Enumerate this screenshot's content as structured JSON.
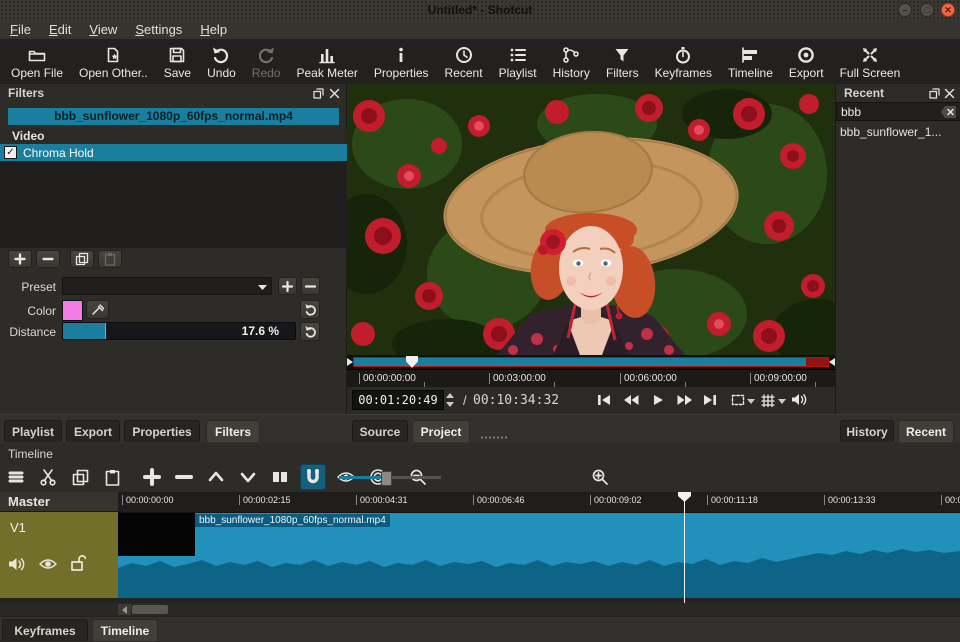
{
  "window": {
    "title": "Untitled* - Shotcut",
    "controls": [
      "minimize",
      "maximize",
      "close"
    ]
  },
  "menu": {
    "items": [
      "File",
      "Edit",
      "View",
      "Settings",
      "Help"
    ]
  },
  "toolbar": {
    "items": [
      {
        "label": "Open File",
        "icon": "open-file-icon"
      },
      {
        "label": "Open Other..",
        "icon": "open-other-icon"
      },
      {
        "label": "Save",
        "icon": "save-icon"
      },
      {
        "label": "Undo",
        "icon": "undo-icon"
      },
      {
        "label": "Redo",
        "icon": "redo-icon",
        "disabled": true
      },
      {
        "label": "Peak Meter",
        "icon": "peak-meter-icon"
      },
      {
        "label": "Properties",
        "icon": "properties-icon"
      },
      {
        "label": "Recent",
        "icon": "recent-icon"
      },
      {
        "label": "Playlist",
        "icon": "playlist-icon"
      },
      {
        "label": "History",
        "icon": "history-icon"
      },
      {
        "label": "Filters",
        "icon": "filters-icon"
      },
      {
        "label": "Keyframes",
        "icon": "keyframes-icon"
      },
      {
        "label": "Timeline",
        "icon": "timeline-icon"
      },
      {
        "label": "Export",
        "icon": "export-icon"
      },
      {
        "label": "Full Screen",
        "icon": "full-screen-icon"
      }
    ]
  },
  "filters_panel": {
    "title": "Filters",
    "clip_name": "bbb_sunflower_1080p_60fps_normal.mp4",
    "section_header": "Video",
    "filters": [
      {
        "name": "Chroma Hold",
        "enabled": true
      }
    ],
    "preset_label": "Preset",
    "color_label": "Color",
    "color_value": "#f07ce4",
    "distance_label": "Distance",
    "distance_value": "17.6 %"
  },
  "player": {
    "ruler_labels": [
      "00:00:00:00",
      "00:03:00:00",
      "00:06:00:00",
      "00:09:00:00"
    ],
    "position": "00:01:20:49",
    "duration_sep": "/",
    "duration": "00:10:34:32",
    "tabs": [
      {
        "label": "Source"
      },
      {
        "label": "Project",
        "active": true
      }
    ]
  },
  "recent_panel": {
    "title": "Recent",
    "search_value": "bbb",
    "items": [
      "bbb_sunflower_1..."
    ],
    "tabs": [
      {
        "label": "History"
      },
      {
        "label": "Recent",
        "active": true
      }
    ]
  },
  "dock_tabs": {
    "items": [
      {
        "label": "Playlist"
      },
      {
        "label": "Export"
      },
      {
        "label": "Properties"
      },
      {
        "label": "Filters",
        "active": true
      }
    ]
  },
  "timeline": {
    "title": "Timeline",
    "ruler_labels": [
      "00:00:00:00",
      "00:00:02:15",
      "00:00:04:31",
      "00:00:06:46",
      "00:00:09:02",
      "00:00:11:18",
      "00:00:13:33",
      "00:0"
    ],
    "master_label": "Master",
    "track_label": "V1",
    "clip_label": "bbb_sunflower_1080p_60fps_normal.mp4",
    "tabs": [
      {
        "label": "Keyframes"
      },
      {
        "label": "Timeline",
        "active": true
      }
    ]
  },
  "colors": {
    "accent": "#1a7f9f",
    "clip": "#2191bb",
    "waveform": "#0d6486",
    "track_header": "#716f29",
    "close_button": "#ef6a45"
  }
}
